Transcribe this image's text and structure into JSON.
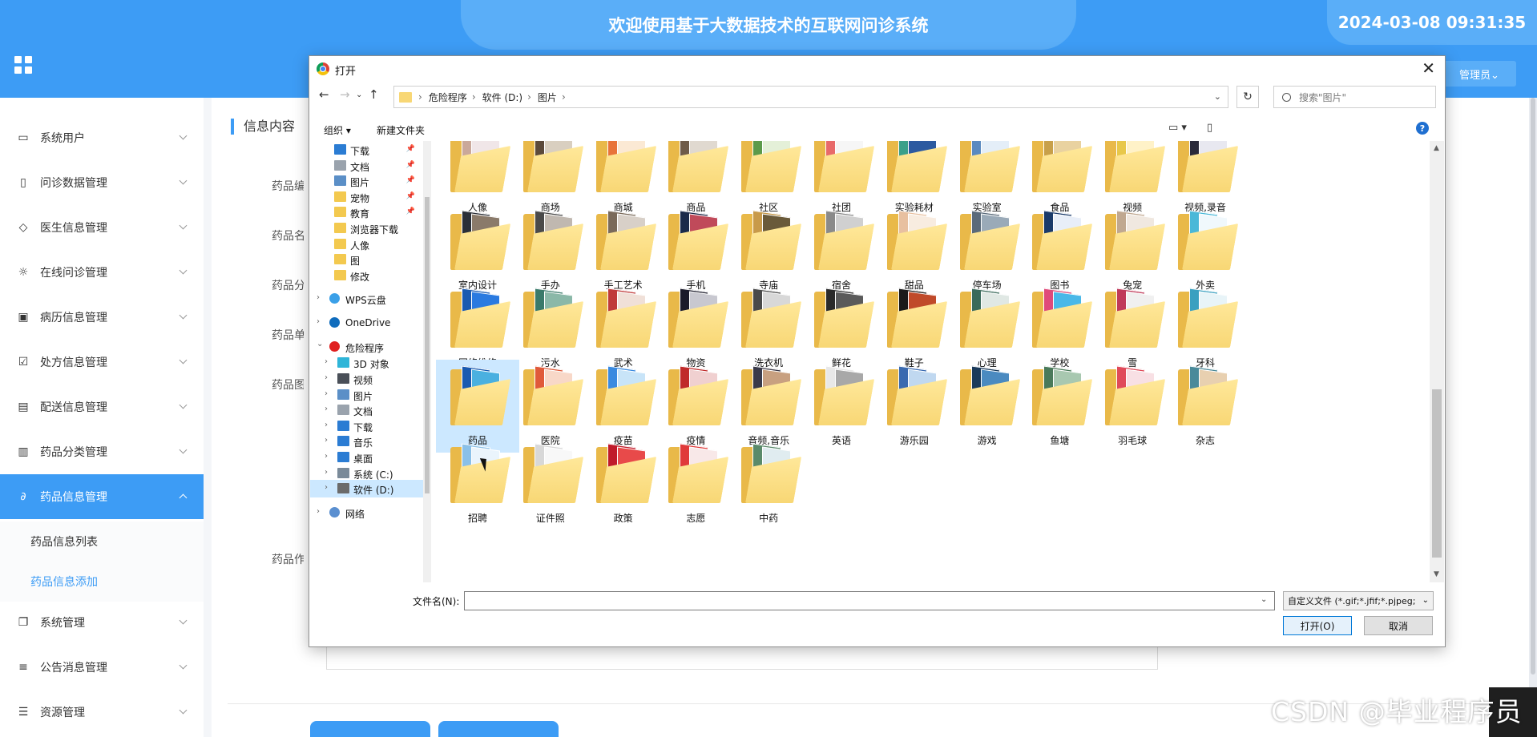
{
  "header": {
    "title": "欢迎使用基于大数据技术的互联网问诊系统",
    "datetime": "2024-03-08 09:31:35",
    "user_menu": "管理员⌄"
  },
  "sidebar": {
    "items": [
      {
        "label": "系统用户",
        "icon": "monitor-icon"
      },
      {
        "label": "问诊数据管理",
        "icon": "bookmark-icon"
      },
      {
        "label": "医生信息管理",
        "icon": "tag-icon"
      },
      {
        "label": "在线问诊管理",
        "icon": "sun-icon"
      },
      {
        "label": "病历信息管理",
        "icon": "inbox-icon"
      },
      {
        "label": "处方信息管理",
        "icon": "clipboard-check-icon"
      },
      {
        "label": "配送信息管理",
        "icon": "message-icon"
      },
      {
        "label": "药品分类管理",
        "icon": "archive-icon"
      },
      {
        "label": "药品信息管理",
        "icon": "paperclip-icon",
        "active": true
      },
      {
        "label": "系统管理",
        "icon": "copy-icon"
      },
      {
        "label": "公告消息管理",
        "icon": "sliders-icon"
      },
      {
        "label": "资源管理",
        "icon": "list-icon"
      }
    ],
    "sub_items": [
      {
        "label": "药品信息列表"
      },
      {
        "label": "药品信息添加",
        "selected": true
      }
    ]
  },
  "form": {
    "section_title": "信息内容",
    "labels": [
      "药品编号",
      "药品名称",
      "药品分类",
      "药品单价",
      "药品图片",
      "药品作用"
    ]
  },
  "dialog": {
    "title": "打开",
    "breadcrumb": [
      "危险程序",
      "软件 (D:)",
      "图片"
    ],
    "search_placeholder": "搜索\"图片\"",
    "toolbar": {
      "organize": "组织 ▾",
      "new_folder": "新建文件夹"
    },
    "tree": [
      {
        "label": "下载",
        "color": "#2b7cd3",
        "pin": true
      },
      {
        "label": "文档",
        "color": "#9aa3ad",
        "pin": true
      },
      {
        "label": "图片",
        "color": "#5b8fc7",
        "pin": true
      },
      {
        "label": "宠物",
        "color": "#f3c94f",
        "pin": true
      },
      {
        "label": "教育",
        "color": "#f3c94f",
        "pin": true
      },
      {
        "label": "浏览器下载",
        "color": "#f3c94f"
      },
      {
        "label": "人像",
        "color": "#f3c94f"
      },
      {
        "label": "图",
        "color": "#f3c94f"
      },
      {
        "label": "修改",
        "color": "#f3c94f"
      },
      {
        "label": "WPS云盘",
        "color": "#3aa0e8",
        "group": true
      },
      {
        "label": "OneDrive",
        "color": "#0f6cbd",
        "group": true
      },
      {
        "label": "危险程序",
        "color": "#e02020",
        "group": true,
        "expanded": true
      },
      {
        "label": "3D 对象",
        "color": "#2fb5d8",
        "child": true
      },
      {
        "label": "视频",
        "color": "#4a4f58",
        "child": true
      },
      {
        "label": "图片",
        "color": "#5b8fc7",
        "child": true
      },
      {
        "label": "文档",
        "color": "#9aa3ad",
        "child": true
      },
      {
        "label": "下载",
        "color": "#2b7cd3",
        "child": true
      },
      {
        "label": "音乐",
        "color": "#2b7cd3",
        "child": true
      },
      {
        "label": "桌面",
        "color": "#2b7cd3",
        "child": true
      },
      {
        "label": "系统 (C:)",
        "color": "#7a8a99",
        "child": true
      },
      {
        "label": "软件 (D:)",
        "color": "#6b6b6b",
        "child": true,
        "selected": true
      },
      {
        "label": "网络",
        "color": "#5a8fd0",
        "group": true
      }
    ],
    "folders": [
      {
        "label": "人像",
        "c1": "#caa89a",
        "c2": "#f0e6e8"
      },
      {
        "label": "商场",
        "c1": "#5c4a3a",
        "c2": "#d9cfc0"
      },
      {
        "label": "商城",
        "c1": "#e8743a",
        "c2": "#fbe9d4"
      },
      {
        "label": "商品",
        "c1": "#6e5b4a",
        "c2": "#e0d9d0"
      },
      {
        "label": "社区",
        "c1": "#5c9a4a",
        "c2": "#e4f0d8"
      },
      {
        "label": "社团",
        "c1": "#e86a6a",
        "c2": "#f6f6f6"
      },
      {
        "label": "实验耗材",
        "c1": "#3aa08a",
        "c2": "#2c5aa0"
      },
      {
        "label": "实验室",
        "c1": "#5a8ac0",
        "c2": "#e4eef8"
      },
      {
        "label": "食品",
        "c1": "#c8a04a",
        "c2": "#e9d2a0"
      },
      {
        "label": "视频",
        "c1": "#e8c84a",
        "c2": "#fff2c8"
      },
      {
        "label": "视频,录音",
        "c1": "#2a2a3a",
        "c2": "#e8e8f0"
      },
      {
        "label": "室内设计",
        "c1": "#2a2f38",
        "c2": "#8a7a6a"
      },
      {
        "label": "手办",
        "c1": "#4a4a4a",
        "c2": "#c0b8b0"
      },
      {
        "label": "手工艺术",
        "c1": "#7a6a5a",
        "c2": "#d8d0c8"
      },
      {
        "label": "手机",
        "c1": "#1a2a4a",
        "c2": "#c04a5a"
      },
      {
        "label": "寺庙",
        "c1": "#c89a4a",
        "c2": "#6a5a3a"
      },
      {
        "label": "宿舍",
        "c1": "#8a8a8a",
        "c2": "#d0d0d0"
      },
      {
        "label": "甜品",
        "c1": "#e8c0a0",
        "c2": "#f8ece0"
      },
      {
        "label": "停车场",
        "c1": "#5a6a7a",
        "c2": "#9aaab8"
      },
      {
        "label": "图书",
        "c1": "#1a3a6a",
        "c2": "#e8eef8"
      },
      {
        "label": "兔宠",
        "c1": "#c0a890",
        "c2": "#f0e8e0"
      },
      {
        "label": "外卖",
        "c1": "#4ab8d8",
        "c2": "#f0f8fc"
      },
      {
        "label": "网络维修",
        "c1": "#1a5ab0",
        "c2": "#2a7ae0"
      },
      {
        "label": "污水",
        "c1": "#3a7a6a",
        "c2": "#8ab8a8"
      },
      {
        "label": "武术",
        "c1": "#c03a3a",
        "c2": "#f0e0d8"
      },
      {
        "label": "物资",
        "c1": "#1a1a2a",
        "c2": "#c8c8d0"
      },
      {
        "label": "洗衣机",
        "c1": "#4a4a4a",
        "c2": "#d8d8d8"
      },
      {
        "label": "鲜花",
        "c1": "#2a2a2a",
        "c2": "#5a5a5a"
      },
      {
        "label": "鞋子",
        "c1": "#1a1a1a",
        "c2": "#c04a2a"
      },
      {
        "label": "心理",
        "c1": "#3a6a5a",
        "c2": "#e0e8e4"
      },
      {
        "label": "学校",
        "c1": "#e04a7a",
        "c2": "#4ab8e8"
      },
      {
        "label": "雪",
        "c1": "#c03a5a",
        "c2": "#f0f0f0"
      },
      {
        "label": "牙科",
        "c1": "#3aa0c0",
        "c2": "#e8f4f8"
      },
      {
        "label": "药品",
        "c1": "#1a5ab0",
        "c2": "#4ab0e0"
      },
      {
        "label": "医院",
        "c1": "#e05a3a",
        "c2": "#f8d8c8"
      },
      {
        "label": "疫苗",
        "c1": "#3a8ae0",
        "c2": "#c8e4f8"
      },
      {
        "label": "疫情",
        "c1": "#c02a2a",
        "c2": "#f0d0d0"
      },
      {
        "label": "音频,音乐",
        "c1": "#3a3a4a",
        "c2": "#c8a080"
      },
      {
        "label": "英语",
        "c1": "#e8e8e8",
        "c2": "#a8a8a8"
      },
      {
        "label": "游乐园",
        "c1": "#3a6ab0",
        "c2": "#c0d8f0"
      },
      {
        "label": "游戏",
        "c1": "#1a3a5a",
        "c2": "#4a8ac0"
      },
      {
        "label": "鱼塘",
        "c1": "#4a7a5a",
        "c2": "#a8c8b0"
      },
      {
        "label": "羽毛球",
        "c1": "#e04a5a",
        "c2": "#f8e0e4"
      },
      {
        "label": "杂志",
        "c1": "#4a8a9a",
        "c2": "#e8d0b0"
      },
      {
        "label": "招聘",
        "c1": "#8ac0e8",
        "c2": "#eaf4fc"
      },
      {
        "label": "证件照",
        "c1": "#d8d8d8",
        "c2": "#f8f8f8"
      },
      {
        "label": "政策",
        "c1": "#c01a2a",
        "c2": "#e84a4a"
      },
      {
        "label": "志愿",
        "c1": "#e03a3a",
        "c2": "#f8e8e8"
      },
      {
        "label": "中药",
        "c1": "#5a8a6a",
        "c2": "#e0ecf0"
      }
    ],
    "selected_folder": "药品",
    "filename_label": "文件名(N):",
    "filter": "自定义文件 (*.gif;*.jfif;*.pjpeg;",
    "open_button": "打开(O)",
    "cancel_button": "取消"
  },
  "watermark": "CSDN @毕业程序员",
  "colors": {
    "primary": "#3d9cf5",
    "primary_light": "#5aaef8",
    "folder": "#f8d775",
    "selection": "#cce8ff"
  }
}
